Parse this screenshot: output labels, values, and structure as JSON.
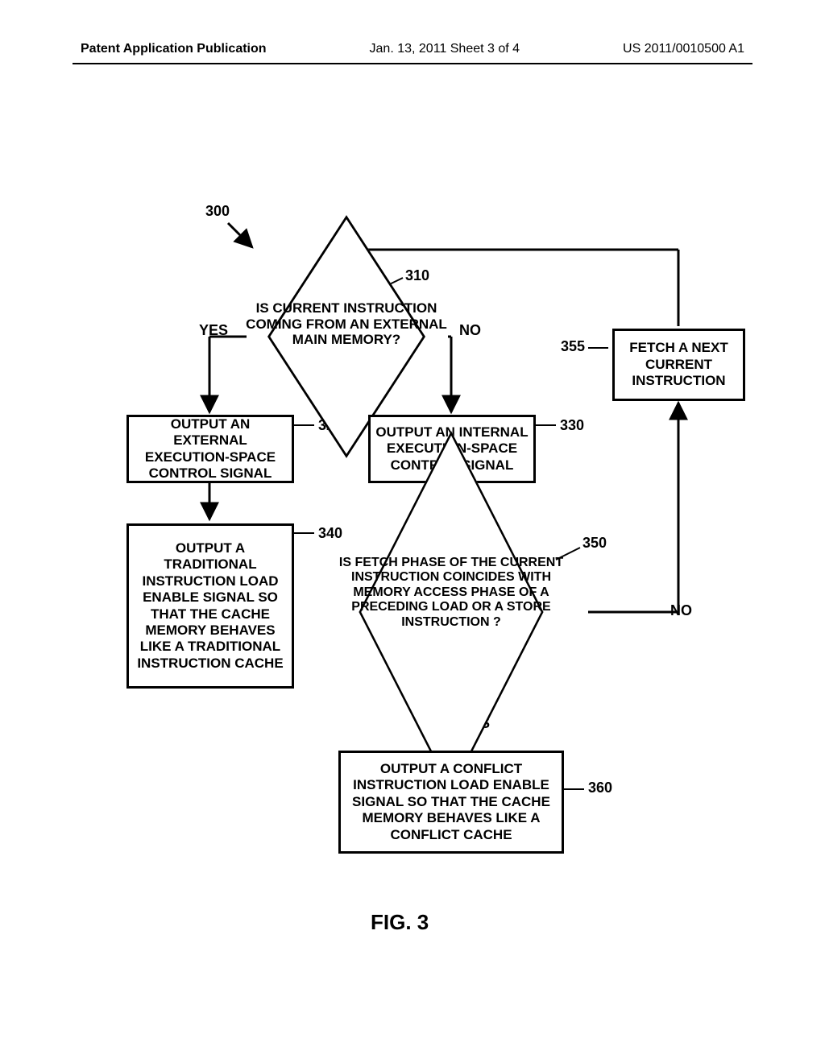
{
  "header": {
    "left": "Patent Application Publication",
    "center": "Jan. 13, 2011  Sheet 3 of 4",
    "right": "US 2011/0010500 A1"
  },
  "labels": {
    "ref300": "300",
    "ref310": "310",
    "ref320": "320",
    "ref330": "330",
    "ref340": "340",
    "ref350": "350",
    "ref355": "355",
    "ref360": "360",
    "yes1": "YES",
    "no1": "NO",
    "yes2": "YES",
    "no2": "NO"
  },
  "nodes": {
    "d310": "IS CURRENT INSTRUCTION COMING FROM AN EXTERNAL MAIN MEMORY?",
    "b320": "OUTPUT AN EXTERNAL EXECUTION-SPACE CONTROL SIGNAL",
    "b330": "OUTPUT AN INTERNAL EXECUTION-SPACE CONTROL SIGNAL",
    "b340": "OUTPUT A TRADITIONAL INSTRUCTION LOAD ENABLE SIGNAL SO THAT THE CACHE MEMORY BEHAVES LIKE A TRADITIONAL INSTRUCTION CACHE",
    "d350": "IS FETCH PHASE OF THE CURRENT INSTRUCTION COINCIDES WITH MEMORY ACCESS PHASE OF A PRECEDING LOAD OR A STORE INSTRUCTION ?",
    "b355": "FETCH A NEXT CURRENT INSTRUCTION",
    "b360": "OUTPUT A CONFLICT INSTRUCTION LOAD ENABLE SIGNAL SO THAT THE CACHE MEMORY BEHAVES LIKE A CONFLICT CACHE"
  },
  "figure": "FIG. 3"
}
